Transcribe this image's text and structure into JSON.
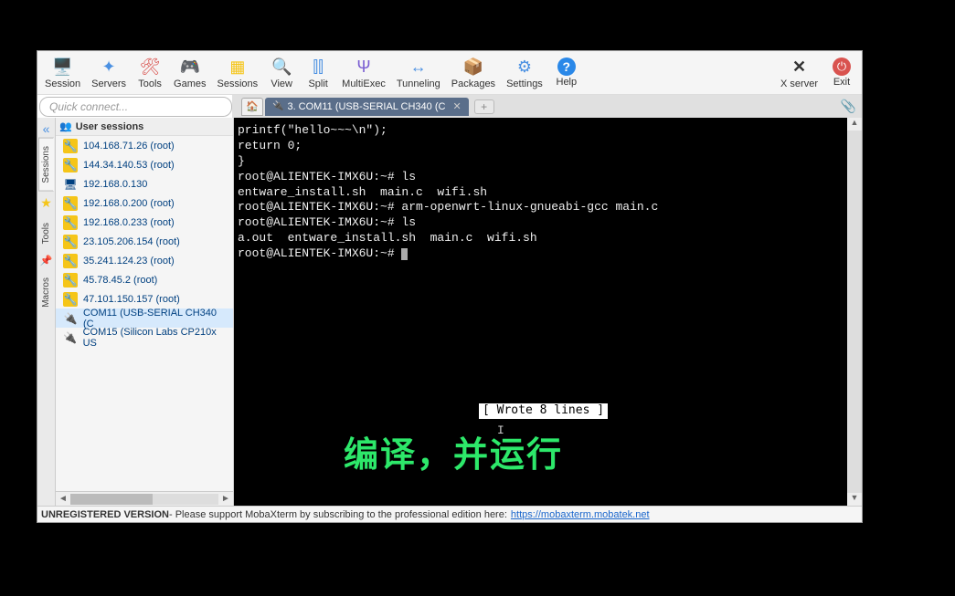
{
  "toolbar": {
    "session": "Session",
    "servers": "Servers",
    "tools": "Tools",
    "games": "Games",
    "sessions": "Sessions",
    "view": "View",
    "split": "Split",
    "multiexec": "MultiExec",
    "tunneling": "Tunneling",
    "packages": "Packages",
    "settings": "Settings",
    "help": "Help",
    "xserver": "X server",
    "exit": "Exit"
  },
  "quick_connect_placeholder": "Quick connect...",
  "tab": {
    "active_label": "3. COM11  (USB-SERIAL CH340 (C"
  },
  "side_tabs": {
    "sessions": "Sessions",
    "tools": "Tools",
    "macros": "Macros"
  },
  "sidebar": {
    "header": "User sessions",
    "items": [
      {
        "label": "104.168.71.26 (root)",
        "type": "ssh"
      },
      {
        "label": "144.34.140.53 (root)",
        "type": "ssh"
      },
      {
        "label": "192.168.0.130",
        "type": "rdp"
      },
      {
        "label": "192.168.0.200 (root)",
        "type": "ssh"
      },
      {
        "label": "192.168.0.233 (root)",
        "type": "ssh"
      },
      {
        "label": "23.105.206.154 (root)",
        "type": "ssh"
      },
      {
        "label": "35.241.124.23 (root)",
        "type": "ssh"
      },
      {
        "label": "45.78.45.2 (root)",
        "type": "ssh"
      },
      {
        "label": "47.101.150.157 (root)",
        "type": "ssh"
      },
      {
        "label": "COM11  (USB-SERIAL CH340 (C",
        "type": "serial",
        "selected": true
      },
      {
        "label": "COM15  (Silicon Labs CP210x US",
        "type": "serial"
      }
    ]
  },
  "terminal": {
    "lines": [
      "printf(\"hello~~~\\n\");",
      "",
      "return 0;",
      "}",
      "",
      "",
      "",
      "",
      "",
      "",
      "",
      "",
      "",
      "",
      "",
      "",
      "",
      "",
      "",
      "",
      "",
      "",
      "",
      "",
      "",
      "root@ALIENTEK-IMX6U:~# ls",
      "entware_install.sh  main.c  wifi.sh",
      "root@ALIENTEK-IMX6U:~# arm-openwrt-linux-gnueabi-gcc main.c",
      "root@ALIENTEK-IMX6U:~# ls",
      "a.out  entware_install.sh  main.c  wifi.sh",
      "root@ALIENTEK-IMX6U:~# "
    ],
    "wrote_badge": "[ Wrote 8 lines ]",
    "overlay": "编译，并运行",
    "caret_glyph": "I"
  },
  "status": {
    "prefix": "UNREGISTERED VERSION",
    "mid": " -  Please support MobaXterm by subscribing to the professional edition here: ",
    "link": "https://mobaxterm.mobatek.net"
  },
  "icons": {
    "session": "🖥️",
    "servers": "✦",
    "tools": "🛠",
    "games": "🎮",
    "sessions_tb": "▦",
    "view": "🔍",
    "split": "⫿⫿",
    "multiexec": "Ψ",
    "tunneling": "↔",
    "packages": "📦",
    "settings": "⚙",
    "help": "?",
    "xserver": "✕",
    "exit": "⏻",
    "home": "🏠",
    "plug": "🔌",
    "folder": "👥"
  }
}
